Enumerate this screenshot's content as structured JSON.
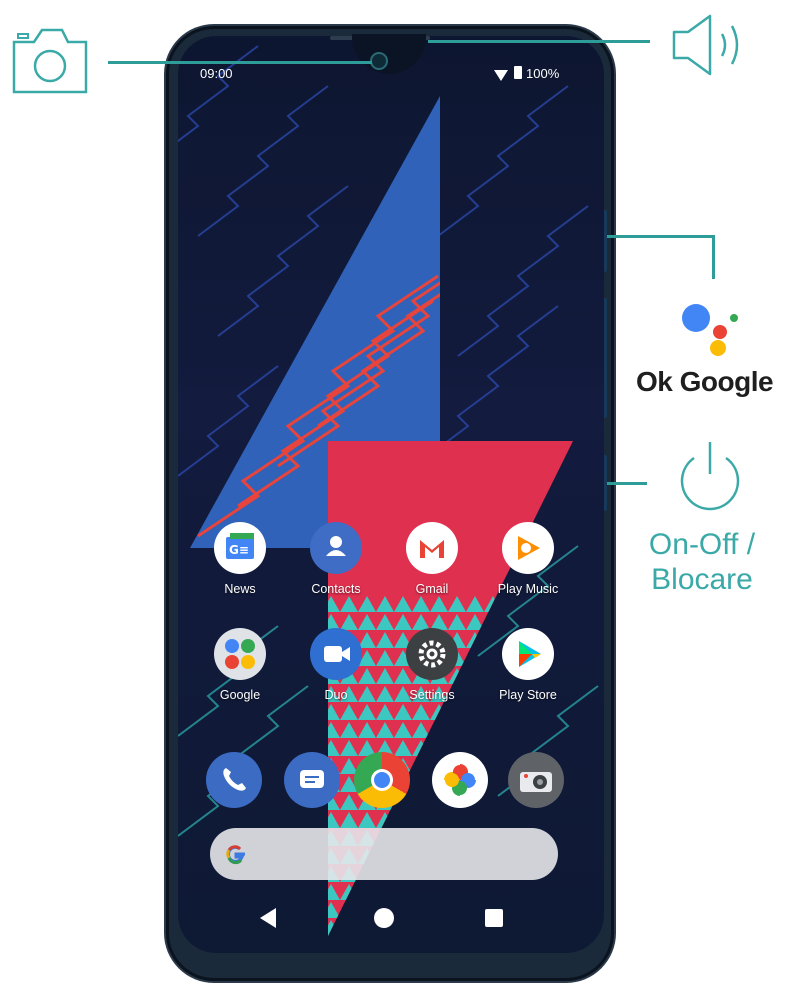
{
  "status_bar": {
    "time": "09:00",
    "battery": "100%"
  },
  "apps_row1": [
    {
      "label": "News"
    },
    {
      "label": "Contacts"
    },
    {
      "label": "Gmail"
    },
    {
      "label": "Play Music"
    }
  ],
  "apps_row2": [
    {
      "label": "Google"
    },
    {
      "label": "Duo"
    },
    {
      "label": "Settings"
    },
    {
      "label": "Play Store"
    }
  ],
  "dock": [
    "phone-icon",
    "messages-icon",
    "chrome-icon",
    "photos-icon",
    "camera-app-icon"
  ],
  "nav": [
    "back-icon",
    "home-icon",
    "recents-icon"
  ],
  "callouts": {
    "assistant_label": "Ok Google",
    "power_label_1": "On-Off /",
    "power_label_2": "Blocare"
  },
  "colors": {
    "accent": "#3aa9a7",
    "wallpaper_red": "#e0304f",
    "wallpaper_blue": "#2a8fd1"
  }
}
